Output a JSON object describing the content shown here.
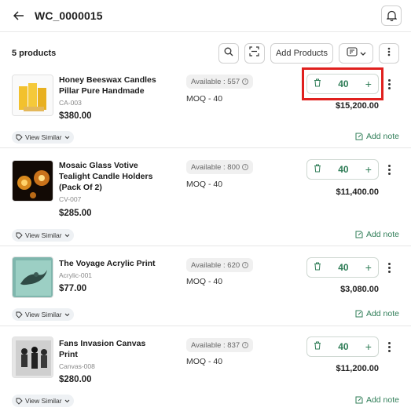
{
  "header": {
    "title": "WC_0000015"
  },
  "toolbar": {
    "count_label": "5 products",
    "add_products_label": "Add Products"
  },
  "products": [
    {
      "name_lines": [
        "Honey Beeswax Candles",
        "Pillar Pure Handmade"
      ],
      "sku": "CA-003",
      "price": "$380.00",
      "available": "Available : 557",
      "moq": "MOQ - 40",
      "quantity": "40",
      "total": "$15,200.00",
      "view_similar": "View Similar",
      "add_note": "Add note"
    },
    {
      "name_lines": [
        "Mosaic Glass Votive",
        "Tealight Candle Holders",
        "(Pack Of 2)"
      ],
      "sku": "CV-007",
      "price": "$285.00",
      "available": "Available : 800",
      "moq": "MOQ - 40",
      "quantity": "40",
      "total": "$11,400.00",
      "view_similar": "View Similar",
      "add_note": "Add note"
    },
    {
      "name_lines": [
        "The Voyage Acrylic Print"
      ],
      "sku": "Acrylic-001",
      "price": "$77.00",
      "available": "Available : 620",
      "moq": "MOQ - 40",
      "quantity": "40",
      "total": "$3,080.00",
      "view_similar": "View Similar",
      "add_note": "Add note"
    },
    {
      "name_lines": [
        "Fans Invasion Canvas",
        "Print"
      ],
      "sku": "Canvas-008",
      "price": "$280.00",
      "available": "Available : 837",
      "moq": "MOQ - 40",
      "quantity": "40",
      "total": "$11,200.00",
      "view_similar": "View Similar",
      "add_note": "Add note"
    }
  ],
  "colors": {
    "accent_green": "#2f7d57",
    "highlight_red": "#e0201e"
  }
}
